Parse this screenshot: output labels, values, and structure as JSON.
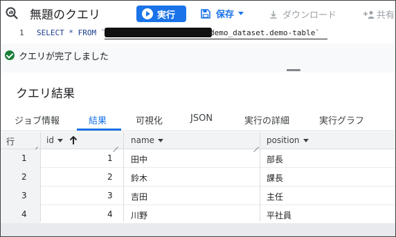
{
  "toolbar": {
    "title": "無題のクエリ",
    "run_label": "実行",
    "save_label": "保存",
    "download_label": "ダウンロード",
    "share_label": "共有"
  },
  "editor": {
    "line_number": "1",
    "code_prefix": "SELECT * FROM `",
    "code_suffix": "demo_dataset.demo-table`"
  },
  "status": {
    "message": "クエリが完了しました"
  },
  "results": {
    "title": "クエリ結果",
    "tabs": [
      "ジョブ情報",
      "結果",
      "可視化",
      "JSON",
      "実行の詳細",
      "実行グラフ"
    ],
    "active_tab": "結果",
    "columns": [
      "行",
      "id",
      "name",
      "position"
    ],
    "rows": [
      {
        "row": "1",
        "id": "1",
        "name": "田中",
        "position": "部長"
      },
      {
        "row": "2",
        "id": "2",
        "name": "鈴木",
        "position": "課長"
      },
      {
        "row": "3",
        "id": "3",
        "name": "吉田",
        "position": "主任"
      },
      {
        "row": "4",
        "id": "4",
        "name": "川野",
        "position": "平社員"
      }
    ]
  },
  "colors": {
    "primary": "#1a73e8",
    "success": "#188038",
    "header_bg": "#f1f3f4"
  },
  "icons": {
    "query": "query-icon",
    "run": "play-icon",
    "save": "save-icon",
    "download": "download-icon",
    "share": "person-add-icon",
    "status": "check-circle-icon",
    "sort": "arrow-up-icon"
  }
}
